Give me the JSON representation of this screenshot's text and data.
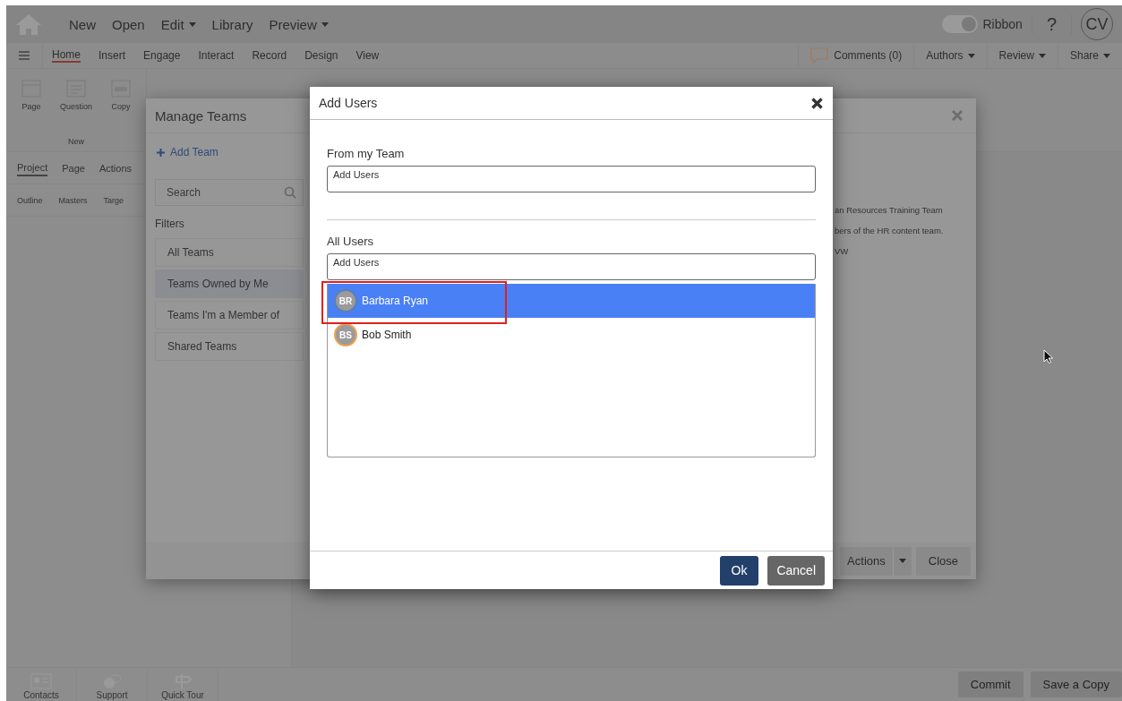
{
  "app_bar": {
    "menu": [
      {
        "label": "New",
        "dropdown": false
      },
      {
        "label": "Open",
        "dropdown": false
      },
      {
        "label": "Edit",
        "dropdown": true
      },
      {
        "label": "Library",
        "dropdown": false
      },
      {
        "label": "Preview",
        "dropdown": true
      }
    ],
    "ribbon_toggle": {
      "label": "Ribbon",
      "on": true
    },
    "help": "?",
    "avatar": "CV"
  },
  "ribbon_tabs": [
    {
      "label": "Home",
      "selected": true
    },
    {
      "label": "Insert",
      "selected": false
    },
    {
      "label": "Engage",
      "selected": false
    },
    {
      "label": "Interact",
      "selected": false
    },
    {
      "label": "Record",
      "selected": false
    },
    {
      "label": "Design",
      "selected": false
    },
    {
      "label": "View",
      "selected": false
    }
  ],
  "header_actions": [
    {
      "label": "Comments",
      "count": "(0)",
      "kind": "comments"
    },
    {
      "label": "Authors",
      "kind": "dropdown"
    },
    {
      "label": "Review",
      "kind": "dropdown"
    },
    {
      "label": "Share",
      "kind": "dropdown"
    }
  ],
  "ribbon": {
    "buttons": [
      {
        "label": "Page",
        "kind": "page"
      },
      {
        "label": "Question",
        "kind": "question"
      },
      {
        "label": "Copy",
        "kind": "copy"
      }
    ],
    "group": "New"
  },
  "panel_tabs": [
    {
      "label": "Project",
      "selected": true
    },
    {
      "label": "Page",
      "selected": false
    },
    {
      "label": "Actions",
      "selected": false
    }
  ],
  "panel_subtabs": [
    "Outline",
    "Masters",
    "Targe"
  ],
  "bottom_bar": {
    "tools": [
      {
        "label": "Contacts",
        "kind": "contacts"
      },
      {
        "label": "Support",
        "kind": "support"
      },
      {
        "label": "Quick Tour",
        "kind": "tour"
      }
    ],
    "buttons": [
      "Commit",
      "Save a Copy"
    ]
  },
  "manage_teams": {
    "title": "Manage Teams",
    "add_button": "Add Team",
    "search": {
      "placeholder": "Search"
    },
    "filters_label": "Filters",
    "filters": [
      {
        "label": "All Teams",
        "selected": false
      },
      {
        "label": "Teams Owned by Me",
        "selected": true
      },
      {
        "label": "Teams I'm a Member of",
        "selected": false
      },
      {
        "label": "Shared Teams",
        "selected": false
      }
    ],
    "details": [
      "an Resources Training Team",
      "bers of the HR content team.",
      "VW"
    ],
    "actions_button": "Actions",
    "close_button": "Close"
  },
  "add_users": {
    "title": "Add Users",
    "sections": [
      {
        "label": "From my Team",
        "field": {
          "placeholder": "Add Users"
        }
      },
      {
        "label": "All Users",
        "field": {
          "placeholder": "Add Users"
        },
        "users": [
          {
            "initials": "BR",
            "name": "Barbara Ryan",
            "selected": true,
            "annotated": true,
            "color": "#5a7fb8"
          },
          {
            "initials": "BS",
            "name": "Bob Smith",
            "selected": false,
            "annotated": false,
            "color": "#f0a050"
          }
        ]
      }
    ],
    "ok_button": "Ok",
    "cancel_button": "Cancel"
  }
}
